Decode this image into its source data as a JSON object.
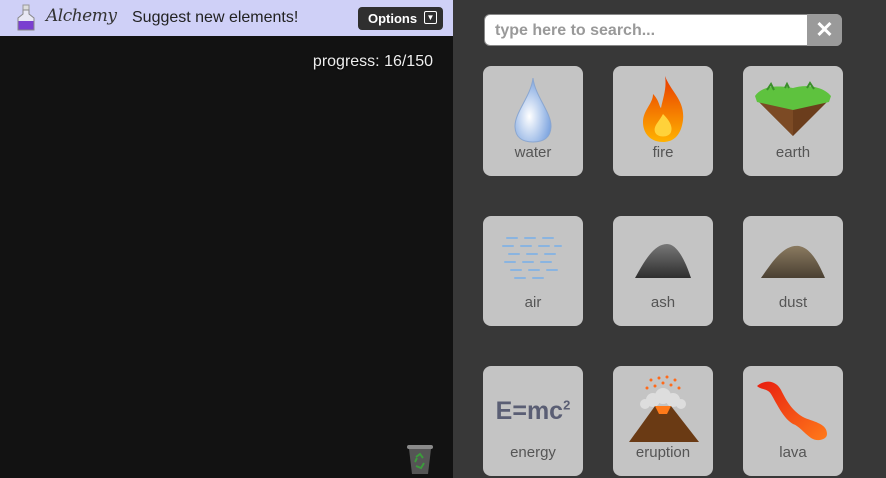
{
  "app": {
    "title": "Alchemy"
  },
  "topbar": {
    "suggest_label": "Suggest new elements!",
    "options_label": "Options",
    "options_arrow": "▼"
  },
  "workspace": {
    "progress_label": "progress: 16/150"
  },
  "search": {
    "placeholder": "type here to search...",
    "value": "",
    "clear_label": "✕"
  },
  "elements": [
    {
      "name": "water",
      "icon": "water-drop-icon"
    },
    {
      "name": "fire",
      "icon": "flame-icon"
    },
    {
      "name": "earth",
      "icon": "earth-chunk-icon"
    },
    {
      "name": "air",
      "icon": "air-lines-icon"
    },
    {
      "name": "ash",
      "icon": "ash-pile-icon"
    },
    {
      "name": "dust",
      "icon": "dust-pile-icon"
    },
    {
      "name": "energy",
      "icon": "energy-formula-icon",
      "formula": "E=mc",
      "superscript": "2"
    },
    {
      "name": "eruption",
      "icon": "volcano-eruption-icon"
    },
    {
      "name": "lava",
      "icon": "lava-flow-icon"
    }
  ],
  "colors": {
    "topbar": "#cfd0f7",
    "workspace": "#121212",
    "panel": "#383838",
    "tile": "#c4c4c4"
  }
}
